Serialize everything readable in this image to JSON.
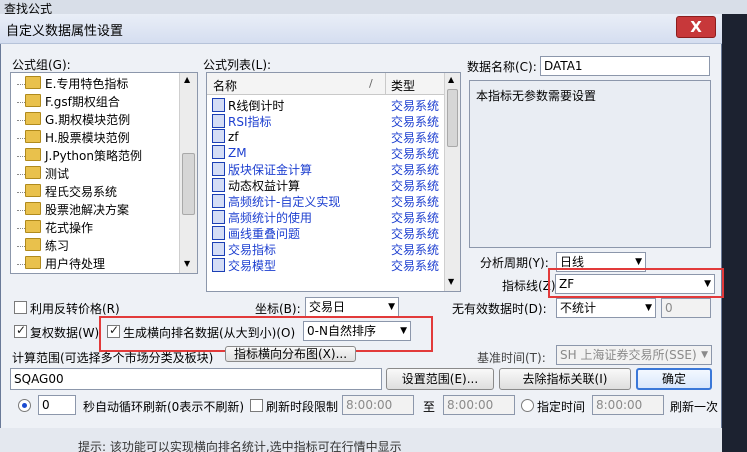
{
  "background": {
    "title": "查找公式"
  },
  "dialog": {
    "title": "自定义数据属性设置",
    "close_label": "X",
    "group_label": "公式组(G):",
    "groups": [
      "E.专用特色指标",
      "F.gsf期权组合",
      "G.期权模块范例",
      "H.股票模块范例",
      "J.Python策略范例",
      "测试",
      "程氏交易系统",
      "股票池解决方案",
      "花式操作",
      "练习",
      "用户待处理"
    ],
    "list_label": "公式列表(L):",
    "col_name": "名称",
    "col_type": "类型",
    "formulas": [
      {
        "name": "R线倒计时",
        "type": "交易系统"
      },
      {
        "name": "RSI指标",
        "type": "交易系统"
      },
      {
        "name": "zf",
        "type": "交易系统"
      },
      {
        "name": "ZM",
        "type": "交易系统"
      },
      {
        "name": "版块保证金计算",
        "type": "交易系统"
      },
      {
        "name": "动态权益计算",
        "type": "交易系统"
      },
      {
        "name": "高频统计-自定义实现",
        "type": "交易系统"
      },
      {
        "name": "高频统计的使用",
        "type": "交易系统"
      },
      {
        "name": "画线重叠问题",
        "type": "交易系统"
      },
      {
        "name": "交易指标",
        "type": "交易系统"
      },
      {
        "name": "交易模型",
        "type": "交易系统"
      }
    ],
    "dataname_label": "数据名称(C):",
    "dataname_value": "DATA1",
    "param_text": "本指标无参数需要设置",
    "period_label": "分析周期(Y):",
    "period_value": "日线",
    "indicator_label": "指标线(Z):",
    "indicator_value": "ZF",
    "reverse_label": "利用反转价格(R)",
    "coord_label": "坐标(B):",
    "coord_value": "交易日",
    "invalid_label": "无有效数据时(D):",
    "invalid_value": "不统计",
    "invalid_num": "0",
    "copy_label": "复权数据(W)",
    "rank_label": "生成横向排名数据(从大到小)(O)",
    "rank_value": "0-N自然排序",
    "range_label": "计算范围(可选择多个市场分类及板块)",
    "chart_btn": "指标横向分布图(X)...",
    "range_value": "SQAG00",
    "basetime_label": "基准时间(T):",
    "basetime_value": "SH 上海证券交易所(SSE)",
    "setrange_btn": "设置范围(E)...",
    "remove_btn": "去除指标关联(I)",
    "ok_btn": "确定",
    "interval_value": "0",
    "interval_label": "秒自动循环刷新(0表示不刷新)",
    "refresh_limit_label": "刷新时段限制",
    "time_from": "8:00:00",
    "to_label": "至",
    "time_to": "8:00:00",
    "specified_label": "指定时间",
    "time_specified": "8:00:00",
    "refresh_once_label": "刷新一次",
    "bottom_hint": "提示: 该功能可以实现横向排名统计,选中指标可在行情中显示"
  }
}
